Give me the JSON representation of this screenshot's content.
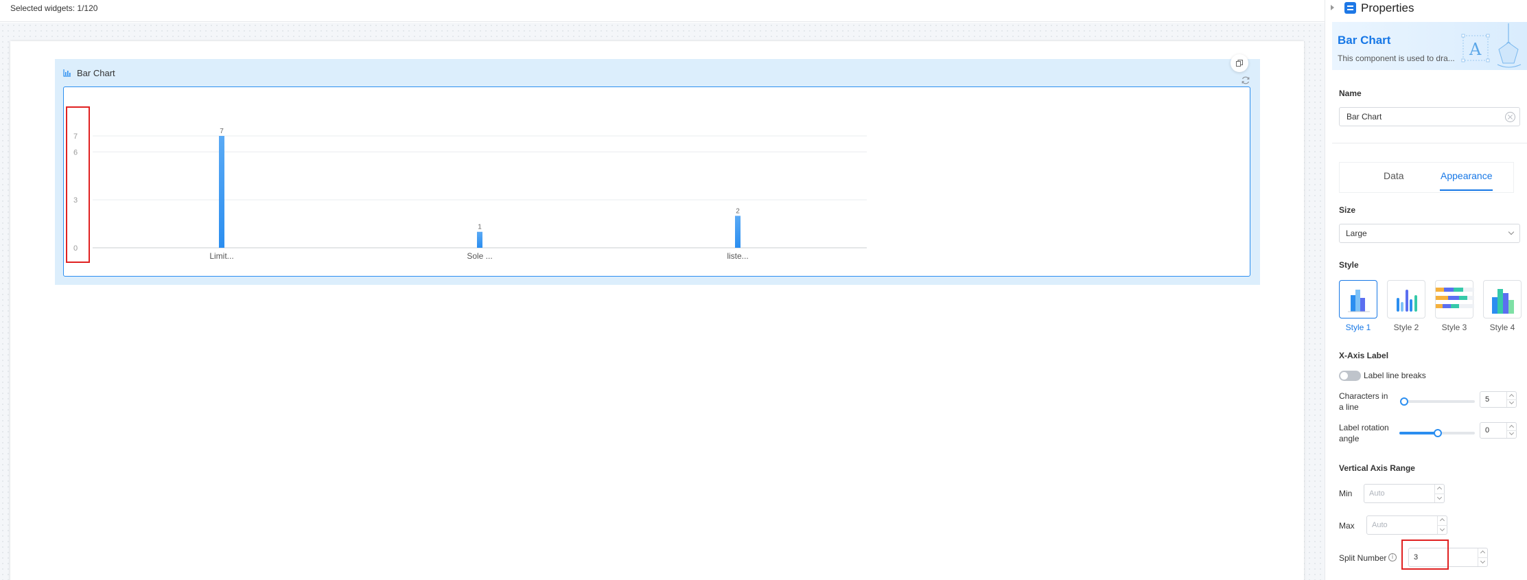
{
  "topbar": {
    "selected_text": "Selected widgets: 1/120"
  },
  "widget": {
    "title": "Bar Chart"
  },
  "chart_data": {
    "type": "bar",
    "categories": [
      "Limit...",
      "Sole ...",
      "liste..."
    ],
    "values": [
      7,
      1,
      2
    ],
    "data_labels": [
      "7",
      "1",
      "2"
    ],
    "y_ticks": [
      0,
      3,
      6,
      7
    ],
    "ylim": [
      0,
      7
    ],
    "grid": true,
    "color": "#2b8ef0"
  },
  "panel": {
    "title": "Properties",
    "component_title": "Bar Chart",
    "component_desc": "This component is used to dra...",
    "name_label": "Name",
    "name_value": "Bar Chart",
    "tabs": [
      {
        "label": "Data",
        "active": false
      },
      {
        "label": "Appearance",
        "active": true
      }
    ],
    "size_label": "Size",
    "size_value": "Large",
    "style_label": "Style",
    "styles": [
      "Style 1",
      "Style 2",
      "Style 3",
      "Style 4"
    ],
    "selected_style": "Style 1",
    "xaxis_label": "X-Axis Label",
    "line_breaks_label": "Label line breaks",
    "line_breaks_on": false,
    "chars_label_1": "Characters in",
    "chars_label_2": "a line",
    "chars_value": "5",
    "chars_slider_fraction": 0.0,
    "rotation_label_1": "Label rotation",
    "rotation_label_2": "angle",
    "rotation_value": "0",
    "rotation_slider_fraction": 0.5,
    "vrange_label": "Vertical Axis Range",
    "min_label": "Min",
    "min_placeholder": "Auto",
    "max_label": "Max",
    "max_placeholder": "Auto",
    "split_label": "Split Number",
    "split_value": "3"
  },
  "colors": {
    "accent": "#1677e6",
    "bar": "#2b8ef0",
    "highlight": "#e02020",
    "widget_bg": "#dceefc"
  }
}
